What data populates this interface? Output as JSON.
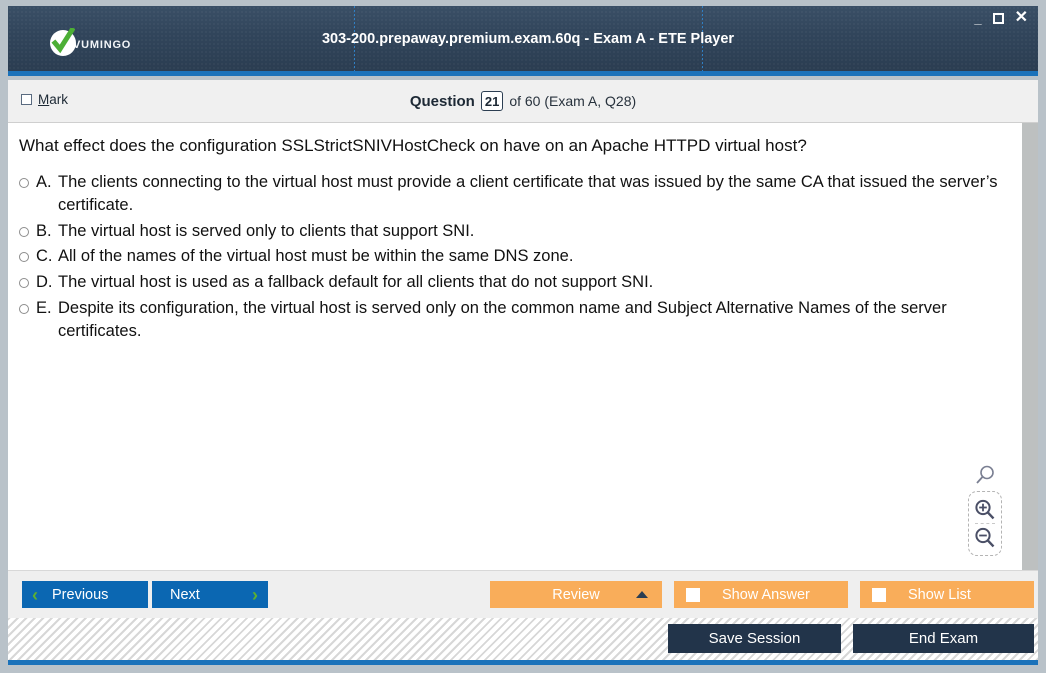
{
  "window": {
    "title": "303-200.prepaway.premium.exam.60q - Exam A - ETE Player",
    "logo_text": "Vumingo",
    "minimize_label": "_",
    "maximize_label": "",
    "close_label": "✕",
    "accent_color": "#1b72ba",
    "titlebar_color": "#2a3c50"
  },
  "header": {
    "mark_label_pre": "M",
    "mark_label_post": "ark",
    "question_word": "Question",
    "question_number": "21",
    "of_text": "of 60 (Exam A, Q28)"
  },
  "question": {
    "text": "What effect does the configuration SSLStrictSNIVHostCheck on have on an Apache HTTPD virtual host?",
    "options": [
      {
        "letter": "A.",
        "text": "The clients connecting to the virtual host must provide a client certificate that was issued by the same CA that issued the server’s certificate.",
        "selected": false
      },
      {
        "letter": "B.",
        "text": "The virtual host is served only to clients that support SNI.",
        "selected": false
      },
      {
        "letter": "C.",
        "text": "All of the names of the virtual host must be within the same DNS zone.",
        "selected": false
      },
      {
        "letter": "D.",
        "text": "The virtual host is used as a fallback default for all clients that do not support SNI.",
        "selected": false
      },
      {
        "letter": "E.",
        "text": "Despite its configuration, the virtual host is served only on the common name and Subject Alternative Names of the server certificates.",
        "selected": false
      }
    ]
  },
  "zoom_controls": {
    "lens_icon": "magnifier-icon",
    "zoom_in_icon": "magnifier-plus-icon",
    "zoom_out_icon": "magnifier-minus-icon"
  },
  "toolbar": {
    "previous_label": "Previous",
    "next_label": "Next",
    "review_label": "Review",
    "show_answer_label": "Show Answer",
    "show_list_label": "Show List",
    "show_answer_checked": false,
    "show_list_checked": false,
    "blue_color": "#0b67b2",
    "orange_color": "#f9ad5a"
  },
  "statusbar": {
    "save_session_label": "Save Session",
    "end_exam_label": "End Exam",
    "navy_color": "#22344a"
  }
}
